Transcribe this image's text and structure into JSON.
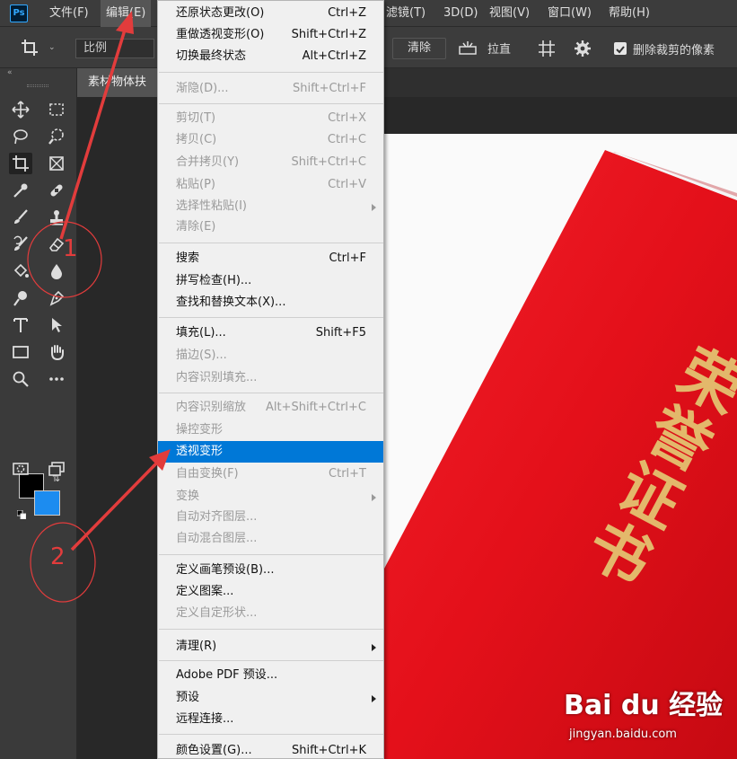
{
  "app": {
    "logo": "Ps"
  },
  "menubar": {
    "file": "文件(F)",
    "edit": "编辑(E)",
    "filter": "滤镜(T)",
    "threed": "3D(D)",
    "view": "视图(V)",
    "window": "窗口(W)",
    "help": "帮助(H)"
  },
  "options": {
    "ratio": "比例",
    "clear": "清除",
    "straighten": "拉直",
    "delete_cropped": "删除裁剪的像素"
  },
  "document": {
    "tab_title": "素材物体扶"
  },
  "colors": {
    "foreground": "#000000",
    "background": "#1c8cf0",
    "highlight": "#0078d7",
    "annotation": "#e23c3c",
    "certificate": "#e8141c",
    "gold": "#e3b86b"
  },
  "edit_menu": {
    "items": [
      {
        "label": "还原状态更改(O)",
        "shortcut": "Ctrl+Z"
      },
      {
        "label": "重做透视变形(O)",
        "shortcut": "Shift+Ctrl+Z"
      },
      {
        "label": "切换最终状态",
        "shortcut": "Alt+Ctrl+Z"
      },
      {
        "label": "渐隐(D)...",
        "shortcut": "Shift+Ctrl+F"
      },
      {
        "label": "剪切(T)",
        "shortcut": "Ctrl+X"
      },
      {
        "label": "拷贝(C)",
        "shortcut": "Ctrl+C"
      },
      {
        "label": "合并拷贝(Y)",
        "shortcut": "Shift+Ctrl+C"
      },
      {
        "label": "粘贴(P)",
        "shortcut": "Ctrl+V"
      },
      {
        "label": "选择性粘贴(I)",
        "shortcut": ""
      },
      {
        "label": "清除(E)",
        "shortcut": ""
      },
      {
        "label": "搜索",
        "shortcut": "Ctrl+F"
      },
      {
        "label": "拼写检查(H)...",
        "shortcut": ""
      },
      {
        "label": "查找和替换文本(X)...",
        "shortcut": ""
      },
      {
        "label": "填充(L)...",
        "shortcut": "Shift+F5"
      },
      {
        "label": "描边(S)...",
        "shortcut": ""
      },
      {
        "label": "内容识别填充...",
        "shortcut": ""
      },
      {
        "label": "内容识别缩放",
        "shortcut": "Alt+Shift+Ctrl+C"
      },
      {
        "label": "操控变形",
        "shortcut": ""
      },
      {
        "label": "透视变形",
        "shortcut": ""
      },
      {
        "label": "自由变换(F)",
        "shortcut": "Ctrl+T"
      },
      {
        "label": "变换",
        "shortcut": ""
      },
      {
        "label": "自动对齐图层...",
        "shortcut": ""
      },
      {
        "label": "自动混合图层...",
        "shortcut": ""
      },
      {
        "label": "定义画笔预设(B)...",
        "shortcut": ""
      },
      {
        "label": "定义图案...",
        "shortcut": ""
      },
      {
        "label": "定义自定形状...",
        "shortcut": ""
      },
      {
        "label": "清理(R)",
        "shortcut": ""
      },
      {
        "label": "Adobe PDF 预设...",
        "shortcut": ""
      },
      {
        "label": "预设",
        "shortcut": ""
      },
      {
        "label": "远程连接...",
        "shortcut": ""
      },
      {
        "label": "颜色设置(G)...",
        "shortcut": "Shift+Ctrl+K"
      }
    ]
  },
  "annotations": {
    "step1": "1",
    "step2": "2"
  },
  "photo": {
    "title": "荣誉证书"
  },
  "watermark": {
    "brand": "Bai du 经验",
    "url": "jingyan.baidu.com"
  }
}
